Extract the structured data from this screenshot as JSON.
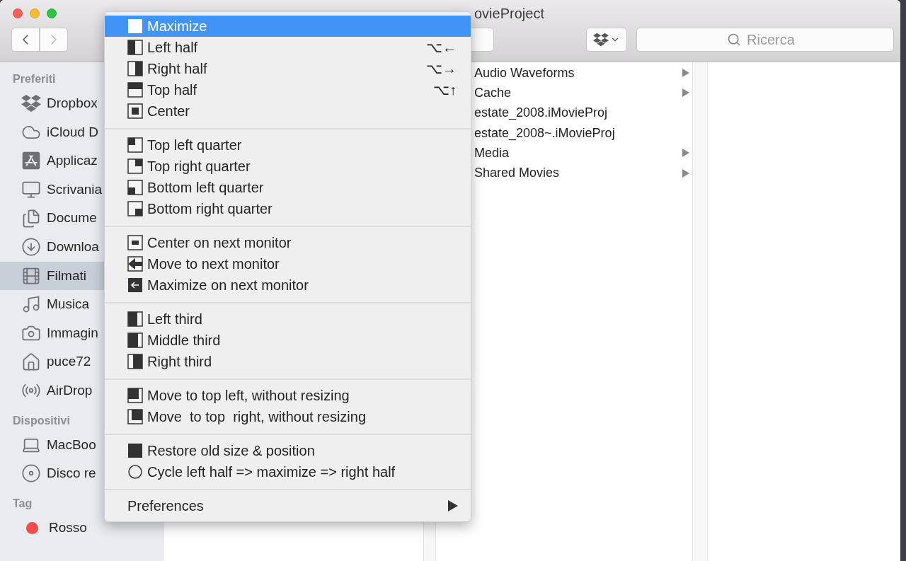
{
  "window": {
    "title": "ovieProject"
  },
  "toolbar": {
    "search": {
      "placeholder": "Ricerca"
    }
  },
  "sidebar": {
    "sections": [
      {
        "heading": "Preferiti",
        "items": [
          {
            "label": "Dropbox",
            "kind": "dropbox",
            "selected": false
          },
          {
            "label": "iCloud D",
            "kind": "cloud",
            "selected": false
          },
          {
            "label": "Applicaz",
            "kind": "apps",
            "selected": false
          },
          {
            "label": "Scrivania",
            "kind": "desktop",
            "selected": false
          },
          {
            "label": "Docume",
            "kind": "documents",
            "selected": false
          },
          {
            "label": "Downloa",
            "kind": "downloads",
            "selected": false
          },
          {
            "label": "Filmati",
            "kind": "movies",
            "selected": true
          },
          {
            "label": "Musica",
            "kind": "music",
            "selected": false
          },
          {
            "label": "Immagin",
            "kind": "pictures",
            "selected": false
          },
          {
            "label": "puce72",
            "kind": "home",
            "selected": false
          },
          {
            "label": "AirDrop",
            "kind": "airdrop",
            "selected": false
          }
        ]
      },
      {
        "heading": "Dispositivi",
        "items": [
          {
            "label": "MacBoo",
            "kind": "laptop",
            "selected": false
          },
          {
            "label": "Disco re",
            "kind": "disc",
            "selected": false
          }
        ]
      },
      {
        "heading": "Tag",
        "items": [
          {
            "label": "Rosso",
            "kind": "tag",
            "color": "#f44b4b",
            "selected": false
          }
        ]
      }
    ]
  },
  "column_2": {
    "items": [
      {
        "label": "Audio Waveforms",
        "folder": true
      },
      {
        "label": "Cache",
        "folder": true
      },
      {
        "label": "estate_2008.iMovieProj",
        "folder": false
      },
      {
        "label": "estate_2008~.iMovieProj",
        "folder": false
      },
      {
        "label": "Media",
        "folder": true
      },
      {
        "label": "Shared Movies",
        "folder": true
      }
    ]
  },
  "menu": {
    "groups": [
      {
        "items": [
          {
            "label": "Maximize",
            "kind": "maximize",
            "selected": true
          },
          {
            "label": "Left half",
            "kind": "left-half",
            "shortcut": "⌥←",
            "selected": false
          },
          {
            "label": "Right half",
            "kind": "right-half",
            "shortcut": "⌥→",
            "selected": false
          },
          {
            "label": "Top half",
            "kind": "top-half",
            "shortcut": "⌥↑",
            "selected": false
          },
          {
            "label": "Center",
            "kind": "center",
            "selected": false
          }
        ]
      },
      {
        "items": [
          {
            "label": "Top left quarter",
            "kind": "top-left",
            "selected": false
          },
          {
            "label": "Top right quarter",
            "kind": "top-right",
            "selected": false
          },
          {
            "label": "Bottom left quarter",
            "kind": "bottom-left",
            "selected": false
          },
          {
            "label": "Bottom right quarter",
            "kind": "bottom-right",
            "selected": false
          }
        ]
      },
      {
        "items": [
          {
            "label": "Center on next monitor",
            "kind": "center-next",
            "selected": false
          },
          {
            "label": "Move to next monitor",
            "kind": "move-next",
            "selected": false
          },
          {
            "label": "Maximize on next monitor",
            "kind": "maximize-next",
            "selected": false
          }
        ]
      },
      {
        "items": [
          {
            "label": "Left third",
            "kind": "left-third",
            "selected": false
          },
          {
            "label": "Middle third",
            "kind": "middle-third",
            "selected": false
          },
          {
            "label": "Right third",
            "kind": "right-third",
            "selected": false
          }
        ]
      },
      {
        "items": [
          {
            "label": "Move to top left, without resizing",
            "kind": "move-top-left",
            "selected": false
          },
          {
            "label": "Move  to top  right, without resizing",
            "kind": "move-top-right",
            "selected": false
          }
        ]
      },
      {
        "items": [
          {
            "label": "Restore old size & position",
            "kind": "restore",
            "selected": false
          },
          {
            "label": "Cycle left half => maximize => right half",
            "kind": "cycle",
            "selected": false
          }
        ]
      },
      {
        "items": [
          {
            "label": "Preferences",
            "kind": "submenu",
            "selected": false
          }
        ]
      }
    ]
  }
}
